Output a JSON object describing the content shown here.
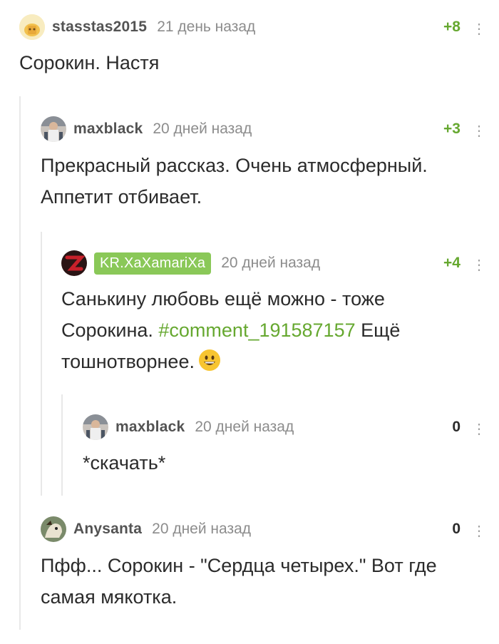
{
  "comments": [
    {
      "username": "stasstas2015",
      "time": "21 день назад",
      "rating": "+8",
      "text": "Сорокин. Настя"
    },
    {
      "username": "maxblack",
      "time": "20 дней назад",
      "rating": "+3",
      "text_line1": "Прекрасный рассказ. Очень атмосферный.",
      "text_line2": "Аппетит отбивает."
    },
    {
      "username": "KR.XaXamariXa",
      "time": "20 дней назад",
      "rating": "+4",
      "text_line1": "Санькину любовь ещё можно - тоже",
      "text_line2_prefix": "Сорокина.",
      "link": "#comment_191587157",
      "text_line2_suffix": "Ещё",
      "text_line3": "тошнотворнее."
    },
    {
      "username": "maxblack",
      "time": "20 дней назад",
      "rating": "0",
      "text": "*скачать*"
    },
    {
      "username": "Anysanta",
      "time": "20 дней назад",
      "rating": "0",
      "text_line1": "Пфф... Сорокин - \"Сердца четырех.\" Вот где",
      "text_line2": "самая мякотка."
    }
  ],
  "icons": {
    "more": "vertical-dots-icon",
    "emoji": "grinning-face-icon"
  },
  "colors": {
    "accent_green": "#66a830",
    "badge_green": "#8ac858",
    "meta_gray": "#8c8c8c"
  }
}
